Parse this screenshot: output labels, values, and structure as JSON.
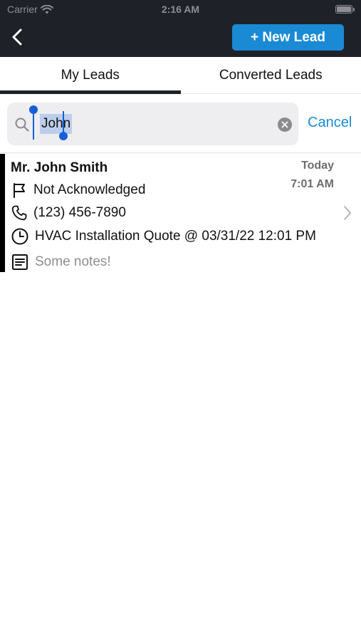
{
  "status_bar": {
    "carrier": "Carrier",
    "time": "2:16 AM",
    "wifi_icon": "wifi-icon",
    "battery_icon": "battery-icon"
  },
  "nav": {
    "back_icon": "chevron-left-icon",
    "new_lead_label": "+ New Lead",
    "accent_color": "#1a8ad4",
    "bar_color": "#1f2129"
  },
  "tabs": [
    {
      "label": "My Leads",
      "active": true
    },
    {
      "label": "Converted Leads",
      "active": false
    }
  ],
  "search": {
    "value": "John",
    "icon": "search-icon",
    "clear_icon": "clear-icon",
    "cancel_label": "Cancel"
  },
  "leads": [
    {
      "name": "Mr. John Smith",
      "date": "Today",
      "time": "7:01 AM",
      "status": "Not Acknowledged",
      "phone": "(123) 456-7890",
      "appointment": "HVAC Installation Quote @ 03/31/22 12:01 PM",
      "notes": "Some notes!",
      "icons": [
        "flag-icon",
        "phone-icon",
        "clock-icon",
        "notes-icon",
        "chevron-right-icon"
      ]
    }
  ]
}
